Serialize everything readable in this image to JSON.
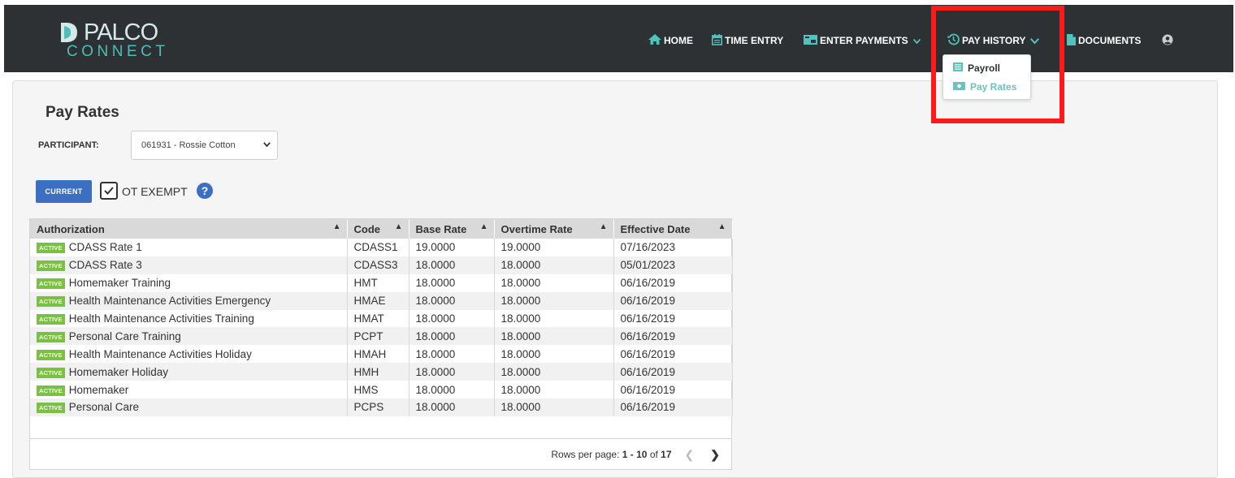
{
  "brand": {
    "word": "PALCO",
    "sub": "CONNECT"
  },
  "nav": {
    "home": "HOME",
    "time_entry": "TIME ENTRY",
    "enter_payments": "ENTER PAYMENTS",
    "pay_history": "PAY HISTORY",
    "documents": "DOCUMENTS"
  },
  "dropdown": {
    "payroll": "Payroll",
    "pay_rates": "Pay Rates"
  },
  "page": {
    "title": "Pay Rates",
    "participant_label": "PARTICIPANT:",
    "participant_value": "061931 - Rossie Cotton",
    "current_button": "CURRENT",
    "ot_exempt": "OT EXEMPT"
  },
  "table": {
    "headers": [
      "Authorization",
      "Code",
      "Base Rate",
      "Overtime Rate",
      "Effective Date"
    ],
    "status_badge": "ACTIVE",
    "rows": [
      [
        "CDASS Rate 1",
        "CDASS1",
        "19.0000",
        "19.0000",
        "07/16/2023"
      ],
      [
        "CDASS Rate 3",
        "CDASS3",
        "18.0000",
        "18.0000",
        "05/01/2023"
      ],
      [
        "Homemaker Training",
        "HMT",
        "18.0000",
        "18.0000",
        "06/16/2019"
      ],
      [
        "Health Maintenance Activities Emergency",
        "HMAE",
        "18.0000",
        "18.0000",
        "06/16/2019"
      ],
      [
        "Health Maintenance Activities Training",
        "HMAT",
        "18.0000",
        "18.0000",
        "06/16/2019"
      ],
      [
        "Personal Care Training",
        "PCPT",
        "18.0000",
        "18.0000",
        "06/16/2019"
      ],
      [
        "Health Maintenance Activities Holiday",
        "HMAH",
        "18.0000",
        "18.0000",
        "06/16/2019"
      ],
      [
        "Homemaker Holiday",
        "HMH",
        "18.0000",
        "18.0000",
        "06/16/2019"
      ],
      [
        "Homemaker",
        "HMS",
        "18.0000",
        "18.0000",
        "06/16/2019"
      ],
      [
        "Personal Care",
        "PCPS",
        "18.0000",
        "18.0000",
        "06/16/2019"
      ]
    ]
  },
  "pager": {
    "label": "Rows per page:",
    "range": "1 - 10",
    "of": "of",
    "total": "17"
  },
  "colors": {
    "nav_bg": "#2d3134",
    "accent": "#4fc3be",
    "primary": "#3c6ec1",
    "badge": "#7ac143",
    "highlight": "#ff1a1a"
  }
}
